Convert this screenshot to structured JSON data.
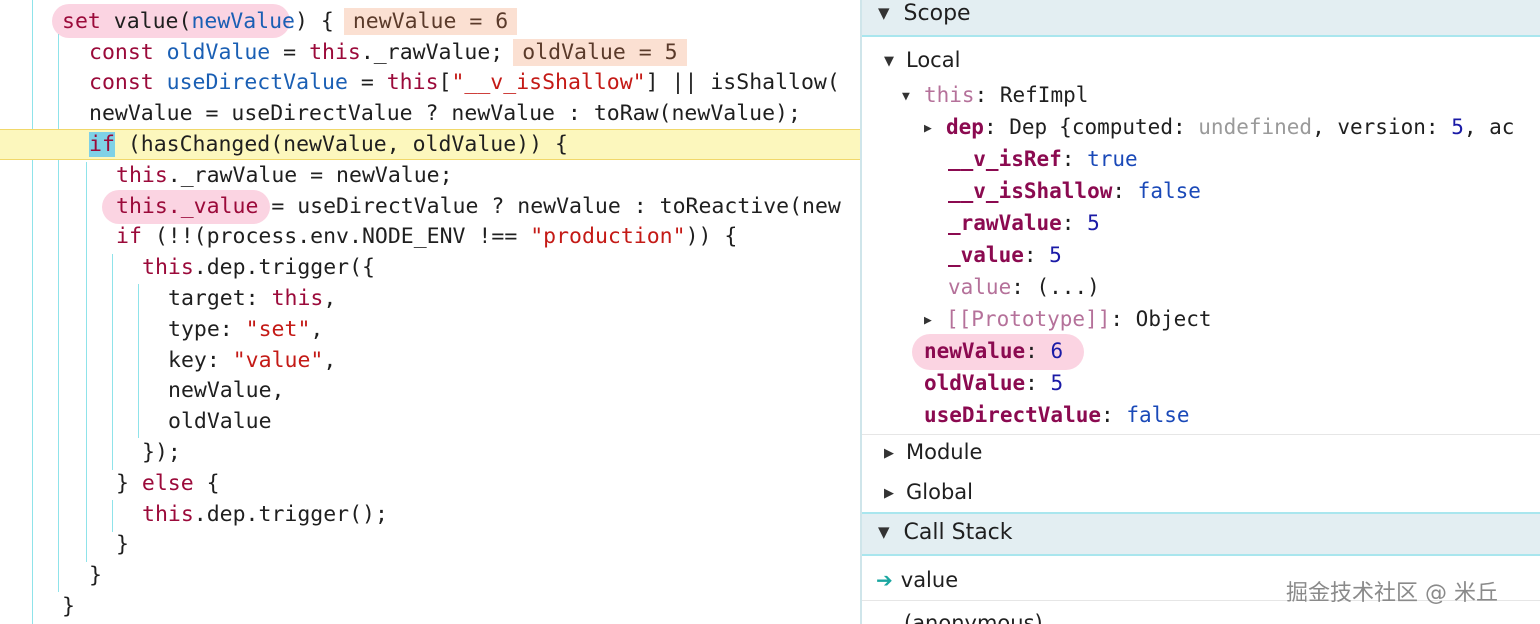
{
  "editor": {
    "line1": {
      "a": "set ",
      "b": "value(",
      "c": "newValue",
      "d": ") {",
      "inline": "newValue = 6"
    },
    "line2": {
      "a": "const ",
      "b": "oldValue",
      "c": " = ",
      "d": "this",
      "e": "._rawValue;",
      "inline": "oldValue = 5"
    },
    "line3": {
      "a": "const ",
      "b": "useDirectValue",
      "c": " = ",
      "d": "this",
      "e": "[",
      "f": "\"__v_isShallow\"",
      "g": "] || isShallow("
    },
    "line4": {
      "a": "newValue = useDirectValue ? newValue : toRaw(newValue);"
    },
    "line5": {
      "a": "if",
      "b": " (hasChanged(newValue, oldValue)) {"
    },
    "line6": {
      "a": "this",
      "b": "._rawValue = newValue;"
    },
    "line7": {
      "a": "this",
      "b": "._value",
      "c": " = useDirectValue ? newValue : toReactive(new"
    },
    "line8": {
      "a": "if",
      "b": " (!!(process.env.NODE_ENV !== ",
      "c": "\"production\"",
      "d": ")) {"
    },
    "line9": {
      "a": "this",
      "b": ".dep.trigger({"
    },
    "line10": {
      "a": "target: ",
      "b": "this",
      "c": ","
    },
    "line11": {
      "a": "type: ",
      "b": "\"set\"",
      "c": ","
    },
    "line12": {
      "a": "key: ",
      "b": "\"value\"",
      "c": ","
    },
    "line13": {
      "a": "newValue,"
    },
    "line14": {
      "a": "oldValue"
    },
    "line15": {
      "a": "});"
    },
    "line16": {
      "a": "} ",
      "b": "else",
      "c": " {"
    },
    "line17": {
      "a": "this",
      "b": ".dep.trigger();"
    },
    "line18": {
      "a": "}"
    },
    "line19": {
      "a": "}"
    },
    "line20": {
      "a": "}"
    }
  },
  "scope": {
    "header": "Scope",
    "local_label": "Local",
    "this_key": "this",
    "this_val": "RefImpl",
    "dep": {
      "key": "dep",
      "type": "Dep",
      "open": "{",
      "p1k": "computed",
      "p1v": "undefined",
      "sep": ", ",
      "p2k": "version",
      "p2v": "5",
      "tail": ", ac"
    },
    "is_ref": {
      "key": "__v_isRef",
      "val": "true"
    },
    "is_shallow": {
      "key": "__v_isShallow",
      "val": "false"
    },
    "raw_value": {
      "key": "_rawValue",
      "val": "5"
    },
    "value_private": {
      "key": "_value",
      "val": "5"
    },
    "value_getter": {
      "key": "value",
      "val": "(...)"
    },
    "prototype": {
      "key": "[[Prototype]]",
      "val": "Object"
    },
    "new_value": {
      "key": "newValue",
      "val": "6"
    },
    "old_value": {
      "key": "oldValue",
      "val": "5"
    },
    "use_direct": {
      "key": "useDirectValue",
      "val": "false"
    },
    "module_label": "Module",
    "global_label": "Global"
  },
  "call_stack": {
    "header": "Call Stack",
    "frames": [
      "value",
      "(anonymous)"
    ]
  },
  "watermark": "掘金技术社区 @ 米丘",
  "colors": {
    "keyword": "#9b0a3a",
    "string": "#c41a16",
    "exec_line": "#fcf7bd",
    "inline_value_bg": "#fbe0d2",
    "highlight_pink": "#f7a0be",
    "section_bg": "#e3eef2",
    "property_key": "#8b0a50"
  }
}
